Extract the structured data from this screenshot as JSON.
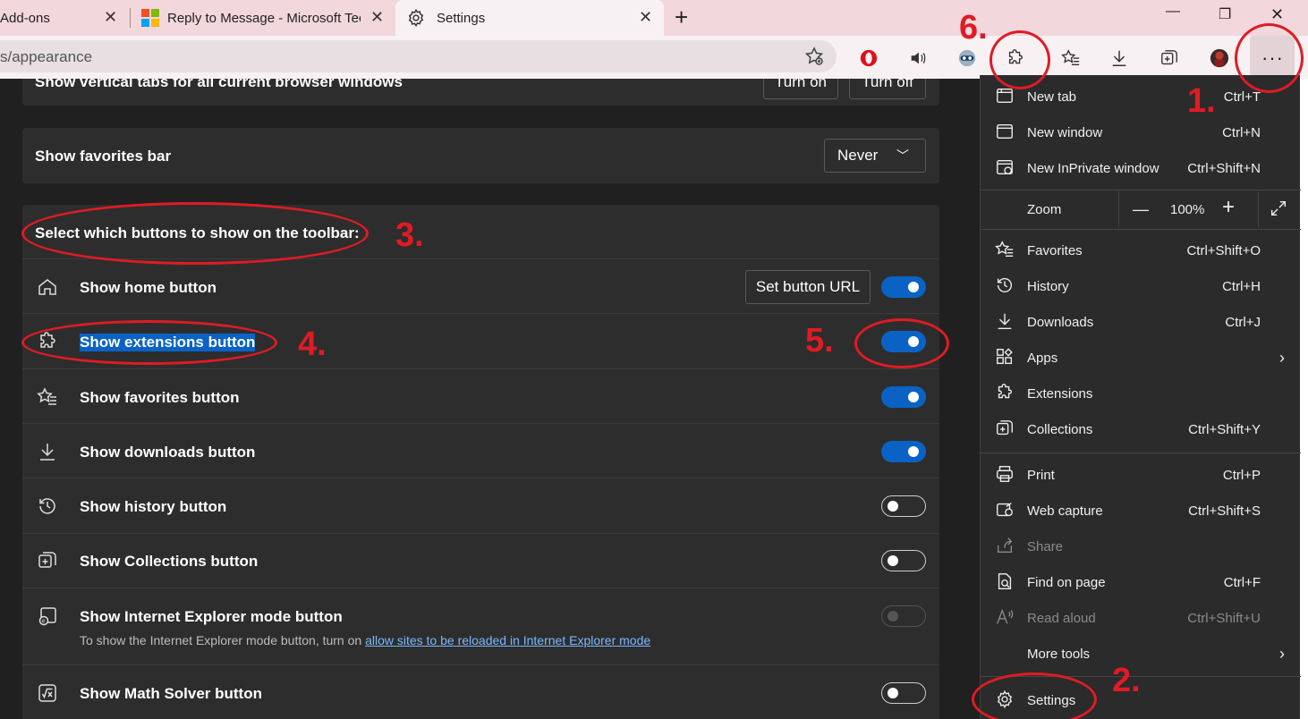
{
  "tabs": [
    {
      "title": "Add-ons"
    },
    {
      "title": "Reply to Message - Microsoft Tec"
    },
    {
      "title": "Settings"
    }
  ],
  "address_bar": {
    "url": "s/appearance"
  },
  "settings": {
    "vertical_tabs_label": "Show vertical tabs for all current browser windows",
    "turn_on": "Turn on",
    "turn_off": "Turn off",
    "favorites_bar_label": "Show favorites bar",
    "favorites_bar_value": "Never",
    "toolbar_heading": "Select which buttons to show on the toolbar:",
    "set_button_url": "Set button URL",
    "rows": [
      {
        "label": "Show home button",
        "icon": "home-icon",
        "state": "on"
      },
      {
        "label": "Show extensions button",
        "icon": "puzzle-icon",
        "state": "on"
      },
      {
        "label": "Show favorites button",
        "icon": "favorites-icon",
        "state": "on"
      },
      {
        "label": "Show downloads button",
        "icon": "download-icon",
        "state": "on"
      },
      {
        "label": "Show history button",
        "icon": "history-icon",
        "state": "off"
      },
      {
        "label": "Show Collections button",
        "icon": "collections-icon",
        "state": "off"
      },
      {
        "label": "Show Internet Explorer mode button",
        "icon": "ie-mode-icon",
        "state": "disabled"
      },
      {
        "label": "Show Math Solver button",
        "icon": "math-solver-icon",
        "state": "off"
      }
    ],
    "ie_note_prefix": "To show the Internet Explorer mode button, turn on ",
    "ie_note_link": "allow sites to be reloaded in Internet Explorer mode"
  },
  "menu": {
    "items": [
      {
        "label": "New tab",
        "shortcut": "Ctrl+T"
      },
      {
        "label": "New window",
        "shortcut": "Ctrl+N"
      },
      {
        "label": "New InPrivate window",
        "shortcut": "Ctrl+Shift+N"
      },
      {
        "label": "Favorites",
        "shortcut": "Ctrl+Shift+O"
      },
      {
        "label": "History",
        "shortcut": "Ctrl+H"
      },
      {
        "label": "Downloads",
        "shortcut": "Ctrl+J"
      },
      {
        "label": "Apps",
        "shortcut": ""
      },
      {
        "label": "Extensions",
        "shortcut": ""
      },
      {
        "label": "Collections",
        "shortcut": "Ctrl+Shift+Y"
      },
      {
        "label": "Print",
        "shortcut": "Ctrl+P"
      },
      {
        "label": "Web capture",
        "shortcut": "Ctrl+Shift+S"
      },
      {
        "label": "Share",
        "shortcut": ""
      },
      {
        "label": "Find on page",
        "shortcut": "Ctrl+F"
      },
      {
        "label": "Read aloud",
        "shortcut": "Ctrl+Shift+U"
      },
      {
        "label": "More tools",
        "shortcut": ""
      },
      {
        "label": "Settings",
        "shortcut": ""
      }
    ],
    "zoom_label": "Zoom",
    "zoom_value": "100%",
    "zoom_minus": "—",
    "zoom_plus": "+"
  },
  "annotations": [
    "1.",
    "2.",
    "3.",
    "4.",
    "5.",
    "6."
  ],
  "colors": {
    "accent": "#0a63c4",
    "annotation": "#e01b24",
    "content_bg": "#202020",
    "card_bg": "#2d2d2d"
  }
}
